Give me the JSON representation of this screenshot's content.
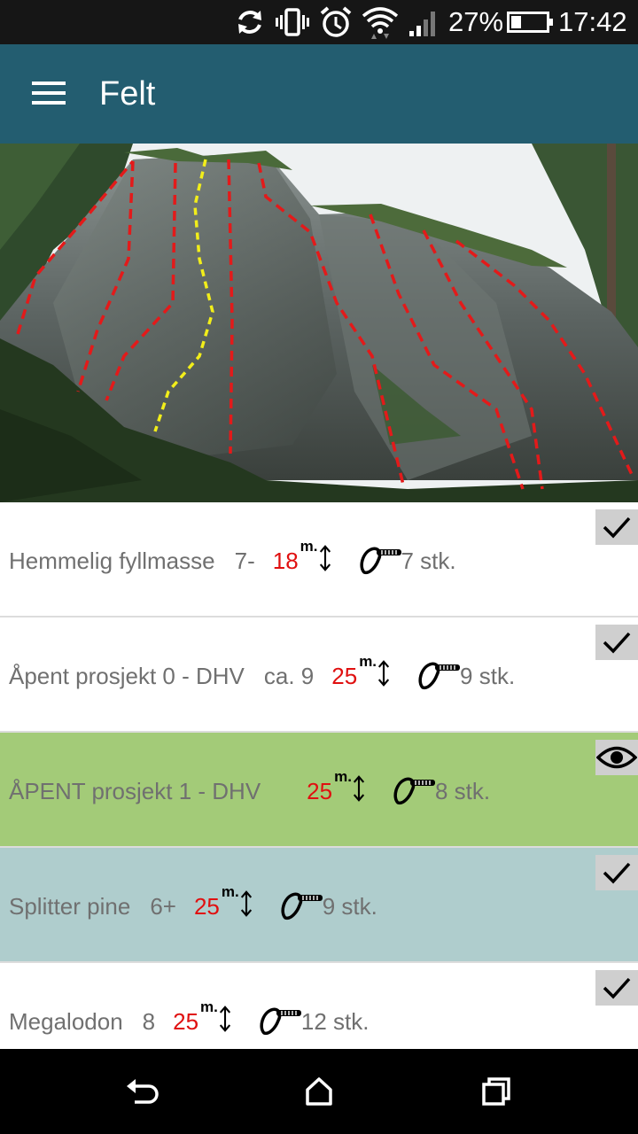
{
  "status_bar": {
    "icons": [
      "sync-icon",
      "vibrate-icon",
      "alarm-icon",
      "wifi-icon",
      "signal-icon"
    ],
    "battery_text": "27%",
    "battery_level": 0.27,
    "time": "17:42"
  },
  "app_bar": {
    "title": "Felt",
    "menu_icon": "hamburger-menu-icon"
  },
  "hero": {
    "image": "cliff-photo-with-route-overlays",
    "colors": {
      "route": "#e31a1a",
      "selected_route": "#f2ee1a"
    }
  },
  "routes": [
    {
      "name": "Hemmelig fyllmasse",
      "grade": "7-",
      "length": "18",
      "length_unit": "m.",
      "bolts": "7 stk.",
      "status_icon": "check-icon",
      "background": "#ffffff"
    },
    {
      "name": "Åpent prosjekt 0 - DHV",
      "grade": "ca. 9",
      "length": "25",
      "length_unit": "m.",
      "bolts": "9 stk.",
      "status_icon": "check-icon",
      "background": "#ffffff"
    },
    {
      "name": "ÅPENT prosjekt 1 - DHV",
      "grade": "",
      "length": "25",
      "length_unit": "m.",
      "bolts": "8 stk.",
      "status_icon": "eye-icon",
      "background": "#a3cb78"
    },
    {
      "name": "Splitter pine",
      "grade": "6+",
      "length": "25",
      "length_unit": "m.",
      "bolts": "9 stk.",
      "status_icon": "check-icon",
      "background": "#afcdcd"
    },
    {
      "name": "Megalodon",
      "grade": "8",
      "length": "25",
      "length_unit": "m.",
      "bolts": "12 stk.",
      "status_icon": "check-icon",
      "background": "#ffffff"
    }
  ],
  "nav_bar": {
    "buttons": [
      "back-icon",
      "home-icon",
      "recents-icon"
    ]
  },
  "colors": {
    "status_bar": "#161616",
    "app_bar": "#235d70",
    "length_text": "#e01010",
    "route_text": "#707070"
  }
}
